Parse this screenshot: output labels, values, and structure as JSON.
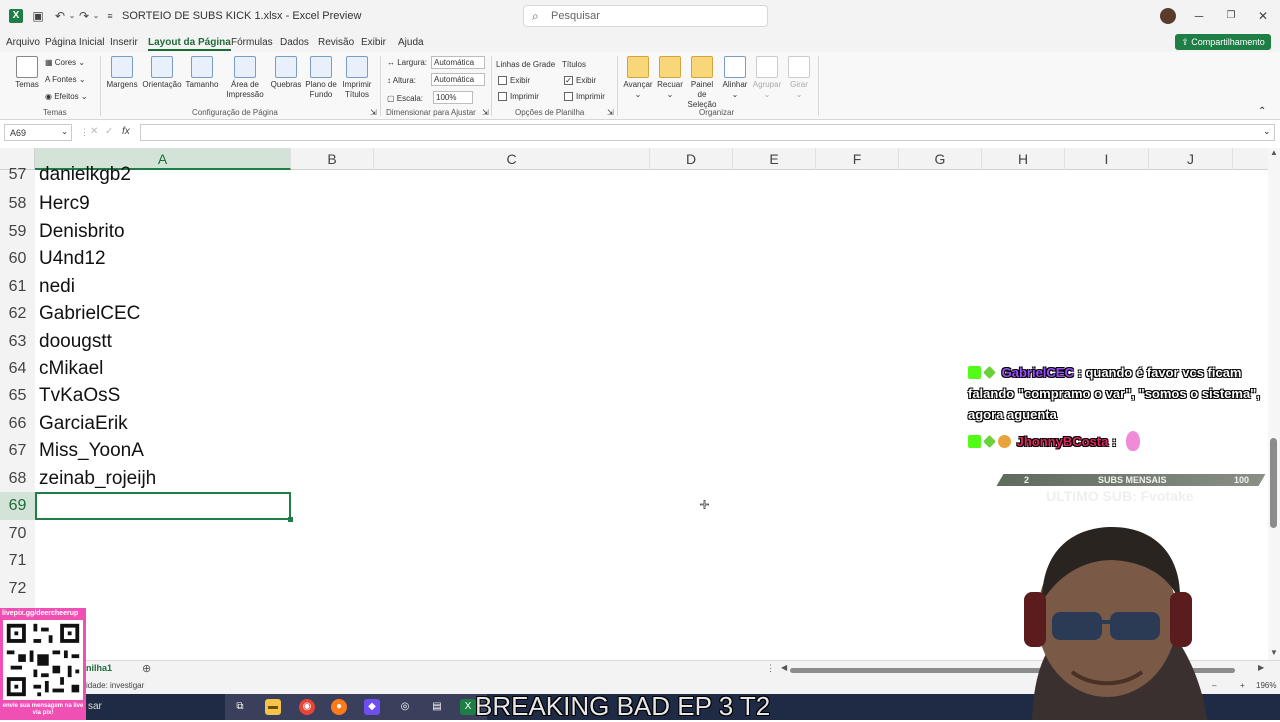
{
  "window": {
    "title": "SORTEIO DE SUBS KICK 1.xlsx  -  Excel Preview",
    "search_placeholder": "Pesquisar"
  },
  "menu": {
    "tabs": [
      "Arquivo",
      "Página Inicial",
      "Inserir",
      "Layout da Página",
      "Fórmulas",
      "Dados",
      "Revisão",
      "Exibir",
      "Ajuda"
    ],
    "active": "Layout da Página",
    "share_label": "Compartilhamento"
  },
  "ribbon": {
    "temas": {
      "label": "Temas",
      "cores": "Cores",
      "fontes": "Fontes",
      "efeitos": "Efeitos",
      "group": "Temas"
    },
    "config": {
      "margens": "Margens",
      "orientacao": "Orientação",
      "tamanho": "Tamanho",
      "area_l1": "Área de",
      "area_l2": "Impressão",
      "quebras": "Quebras",
      "plano_l1": "Plano de",
      "plano_l2": "Fundo",
      "imprimir_l1": "Imprimir",
      "imprimir_l2": "Títulos",
      "group": "Configuração de Página"
    },
    "dimensionar": {
      "largura_label": "Largura:",
      "largura_value": "Automática",
      "altura_label": "Altura:",
      "altura_value": "Automática",
      "escala_label": "Escala:",
      "escala_value": "100%",
      "group": "Dimensionar para Ajustar"
    },
    "opcoes": {
      "linhas_title": "Linhas de Grade",
      "titulos_title": "Títulos",
      "exibir": "Exibir",
      "imprimir": "Imprimir",
      "group": "Opções de Planilha"
    },
    "organizar": {
      "avancar": "Avançar",
      "recuar": "Recuar",
      "painel_l1": "Painel de",
      "painel_l2": "Seleção",
      "alinhar": "Alinhar",
      "agrupar": "Agrupar",
      "girar": "Girar",
      "group": "Organizar"
    }
  },
  "formula_bar": {
    "name_box": "A69",
    "fx": "fx"
  },
  "grid": {
    "columns": [
      "A",
      "B",
      "C",
      "D",
      "E",
      "F",
      "G",
      "H",
      "I",
      "J"
    ],
    "selected_column": "A",
    "rows": [
      {
        "num": "57",
        "value": "danielkgb2"
      },
      {
        "num": "58",
        "value": "Herc9"
      },
      {
        "num": "59",
        "value": "Denisbrito"
      },
      {
        "num": "60",
        "value": "U4nd12"
      },
      {
        "num": "61",
        "value": "nedi"
      },
      {
        "num": "62",
        "value": "GabrielCEC"
      },
      {
        "num": "63",
        "value": "doougstt"
      },
      {
        "num": "64",
        "value": "cMikael"
      },
      {
        "num": "65",
        "value": "TvKaOsS"
      },
      {
        "num": "66",
        "value": "GarciaErik"
      },
      {
        "num": "67",
        "value": "Miss_YoonA"
      },
      {
        "num": "68",
        "value": "zeinab_rojeijh"
      },
      {
        "num": "69",
        "value": ""
      },
      {
        "num": "70",
        "value": ""
      },
      {
        "num": "71",
        "value": ""
      },
      {
        "num": "72",
        "value": ""
      }
    ],
    "selected_row": "69"
  },
  "sheet": {
    "tab_label": "nilha1",
    "status_text": "idade: investigar",
    "zoom": "196%",
    "taskbar_search": "sar"
  },
  "overlay": {
    "chat": [
      {
        "user": "GabrielCEC",
        "user_color": "#9b4dff",
        "message": ": quando é favor vcs ficam falando \"compramo o var\", \"somos o sistema\", agora aguenta"
      },
      {
        "user": "JhonnyBCosta",
        "user_color": "#e0245e",
        "message": ":"
      }
    ],
    "subs": {
      "current": "2",
      "label": "SUBS MENSAIS",
      "goal": "100"
    },
    "last_sub": "ULTIMO SUB: Fvotake",
    "qr_top": "livepix.gg/deercheerup",
    "qr_bottom": "envie sua mensagem na live via pix!",
    "banner": "BREAKING BAD EP 3 T2"
  },
  "colors": {
    "excel_green": "#1e7e45",
    "accent_dark": "#1e6b3a",
    "taskbar": "#1f2a44",
    "qr_panel": "#f04fb4"
  }
}
